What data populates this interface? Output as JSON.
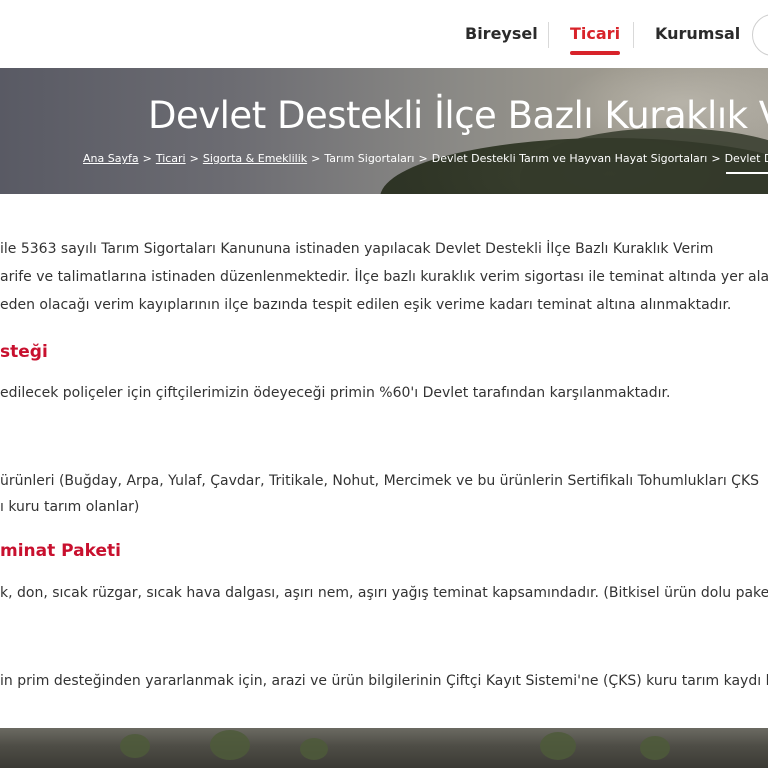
{
  "nav": {
    "items": [
      {
        "label": "Bireysel"
      },
      {
        "label": "Ticari"
      },
      {
        "label": "Kurumsal"
      }
    ]
  },
  "hero": {
    "title": "Devlet Destekli İlçe Bazlı Kuraklık Verim",
    "breadcrumb": [
      "Ana Sayfa",
      "Ticari",
      "Sigorta & Emeklilik",
      "Tarım Sigortaları",
      "Devlet Destekli Tarım ve Hayvan Hayat Sigortaları",
      "Devlet D"
    ]
  },
  "content": {
    "p1_line1": "ile 5363 sayılı Tarım Sigortaları Kanununa istinaden yapılacak Devlet Destekli İlçe Bazlı Kuraklık Verim",
    "p1_line2": "arife ve talimatlarına istinaden düzenlenmektedir. İlçe bazlı kuraklık verim sigortası ile teminat altında yer alan",
    "p1_line3": "eden olacağı verim kayıplarının ilçe bazında tespit edilen eşik verime kadarı teminat altına alınmaktadır.",
    "h1": "steği",
    "p2": "edilecek poliçeler için çiftçilerimizin ödeyeceği primin %60'ı Devlet tarafından karşılanmaktadır.",
    "h2": "",
    "p3_line1": "ürünleri (Buğday, Arpa, Yulaf, Çavdar, Tritikale, Nohut, Mercimek ve bu ürünlerin Sertifikalı Tohumlukları ÇKS",
    "p3_line2": "ı kuru tarım olanlar)",
    "h3": "minat Paketi",
    "p4": "k, don, sıcak rüzgar, sıcak hava dalgası, aşırı nem, aşırı yağış teminat kapsamındadır. (Bitkisel ürün dolu paket",
    "p5": "in prim desteğinden yararlanmak için, arazi ve ürün bilgilerinin Çiftçi Kayıt Sistemi'ne (ÇKS) kuru tarım kaydı b"
  },
  "colors": {
    "accent": "#d8232a",
    "heading": "#c8102e",
    "text": "#333333"
  }
}
